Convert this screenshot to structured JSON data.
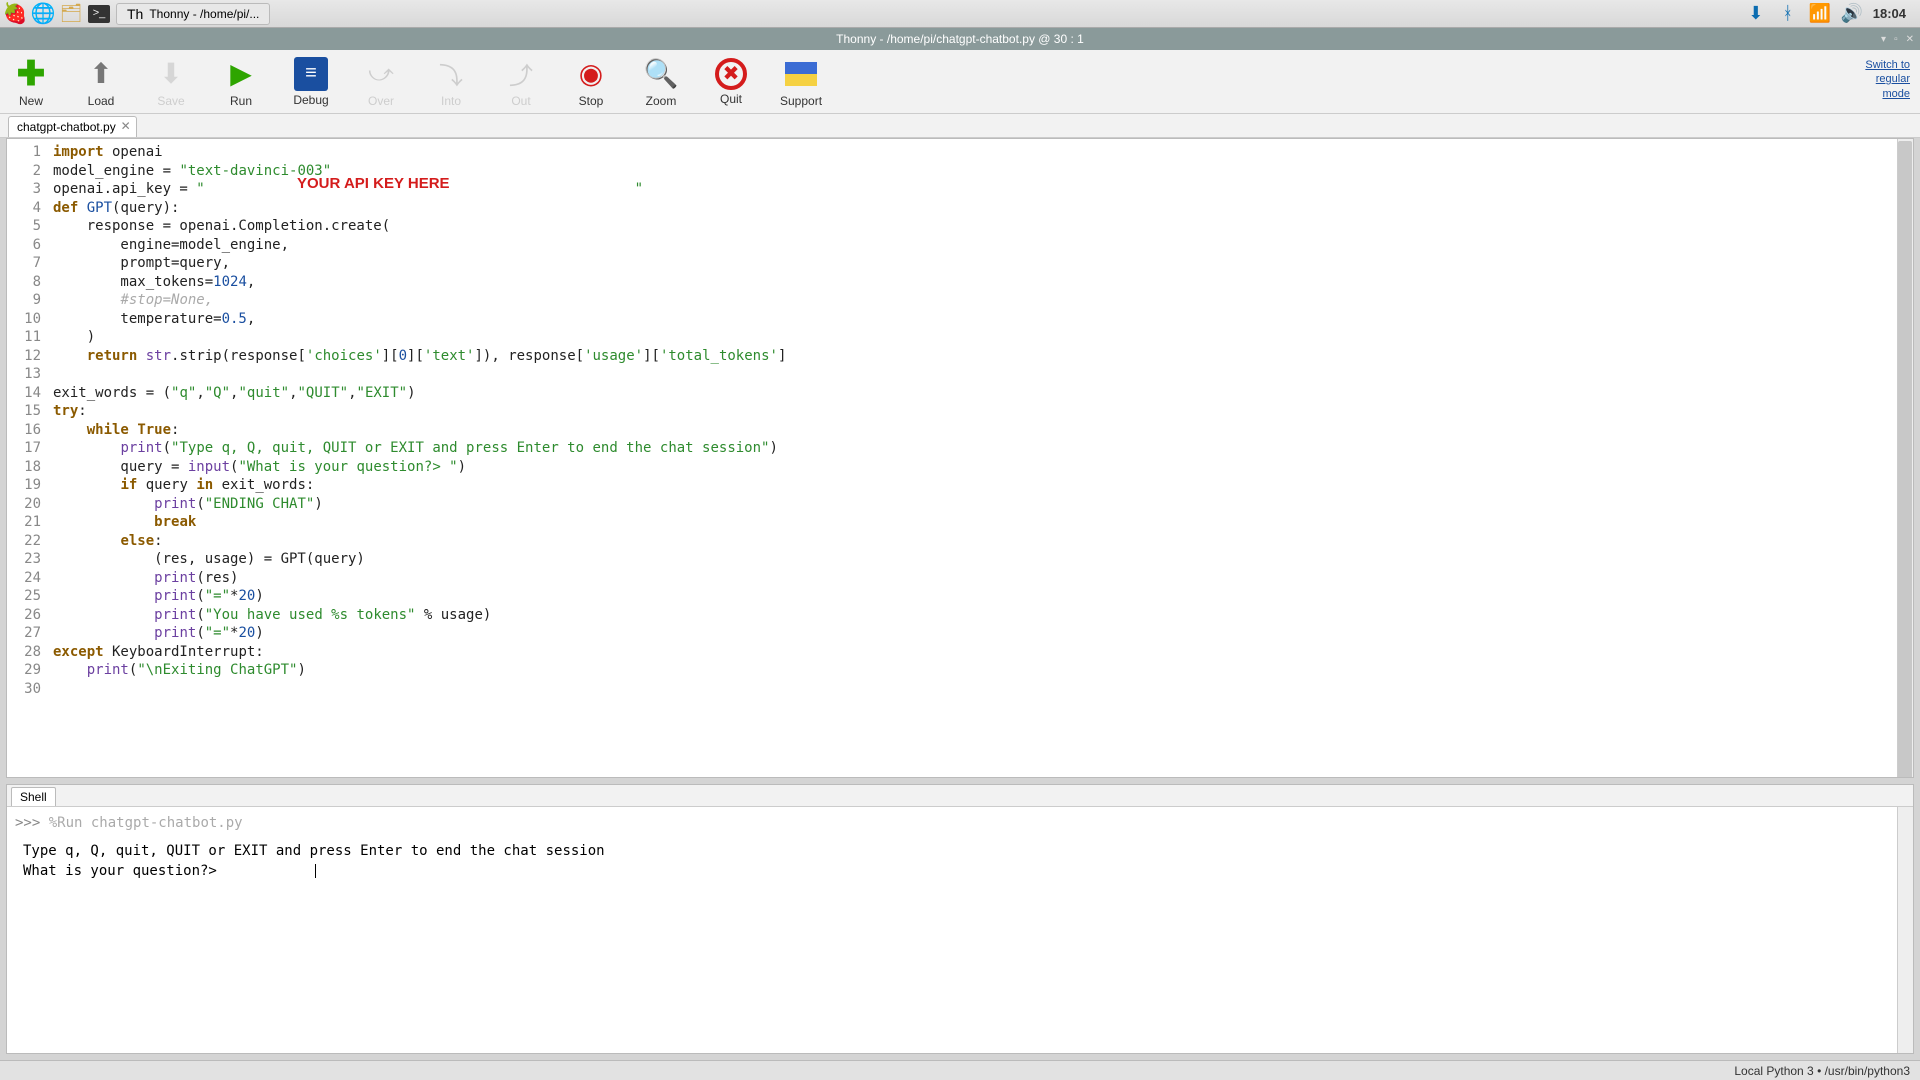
{
  "taskbar": {
    "task_label": "Thonny  -  /home/pi/...",
    "clock": "18:04"
  },
  "window": {
    "title": "Thonny  -  /home/pi/chatgpt-chatbot.py  @  30 : 1"
  },
  "toolbar": {
    "new": "New",
    "load": "Load",
    "save": "Save",
    "run": "Run",
    "debug": "Debug",
    "over": "Over",
    "into": "Into",
    "out": "Out",
    "stop": "Stop",
    "zoom": "Zoom",
    "quit": "Quit",
    "support": "Support",
    "switch_mode": "Switch to\nregular\nmode"
  },
  "tabs": {
    "editor_tab": "chatgpt-chatbot.py",
    "shell_tab": "Shell"
  },
  "code": {
    "api_overlay": "YOUR API KEY HERE",
    "lines": 30
  },
  "shell": {
    "prompt": ">>>",
    "run_cmd": "%Run chatgpt-chatbot.py",
    "out1": "Type q, Q, quit, QUIT or EXIT and press Enter to end the chat session",
    "out2": "What is your question?> "
  },
  "statusbar": {
    "text": "Local Python 3  •  /usr/bin/python3"
  }
}
